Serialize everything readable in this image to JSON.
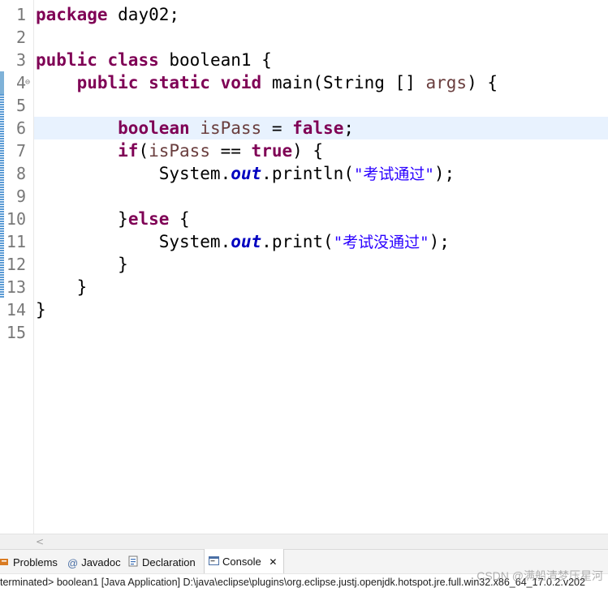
{
  "editor": {
    "line_numbers": [
      "1",
      "2",
      "3",
      "4",
      "5",
      "6",
      "7",
      "8",
      "9",
      "10",
      "11",
      "12",
      "13",
      "14",
      "15"
    ],
    "current_line": 6,
    "folded_marker": "⊖",
    "code": {
      "l1_kw": "package",
      "l1_rest": " day02;",
      "l3_kw1": "public",
      "l3_kw2": "class",
      "l3_rest": " boolean1 {",
      "l4_indent": "    ",
      "l4_kw1": "public",
      "l4_kw2": "static",
      "l4_kw3": "void",
      "l4_rest1": " main(String [] ",
      "l4_arg": "args",
      "l4_rest2": ") {",
      "l6_indent": "        ",
      "l6_kw": "boolean",
      "l6_var": " isPass",
      "l6_op": " = ",
      "l6_val": "false",
      "l6_end": ";",
      "l7_indent": "        ",
      "l7_kw": "if",
      "l7_open": "(",
      "l7_var": "isPass",
      "l7_op": " == ",
      "l7_val": "true",
      "l7_end": ") {",
      "l8_indent": "            ",
      "l8_sys": "System.",
      "l8_out": "out",
      "l8_mid": ".println(",
      "l8_str": "\"考试通过\"",
      "l8_end": ");",
      "l10_indent": "        ",
      "l10_brace": "}",
      "l10_kw": "else",
      "l10_end": " {",
      "l11_indent": "            ",
      "l11_sys": "System.",
      "l11_out": "out",
      "l11_mid": ".print(",
      "l11_str": "\"考试没通过\"",
      "l11_end": ");",
      "l12": "        }",
      "l13": "    }",
      "l14": "}"
    }
  },
  "scrollbar": {
    "left_arrow": "<"
  },
  "tabs": [
    {
      "label": "Problems",
      "icon": "problems-icon"
    },
    {
      "label": "Javadoc",
      "icon": "at-icon"
    },
    {
      "label": "Declaration",
      "icon": "declaration-icon"
    },
    {
      "label": "Console",
      "icon": "console-icon",
      "active": true
    }
  ],
  "close_glyph": "✕",
  "status": {
    "text": "terminated> boolean1 [Java Application] D:\\java\\eclipse\\plugins\\org.eclipse.justj.openjdk.hotspot.jre.full.win32.x86_64_17.0.2.v202"
  },
  "watermark": "CSDN @满船清梦压星河",
  "colors": {
    "keyword": "#7f0055",
    "string": "#2a00ff",
    "field": "#0000c0",
    "current_line": "#e8f2fe"
  }
}
